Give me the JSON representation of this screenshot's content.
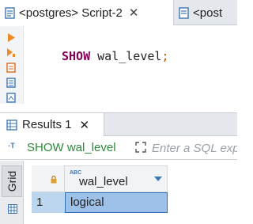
{
  "editor": {
    "tabs": [
      {
        "label": "<postgres> Script-2",
        "close": "✕"
      },
      {
        "label": "<post"
      }
    ],
    "code": {
      "keyword": "SHOW",
      "identifier": "wal_level",
      "terminator": ";"
    },
    "scroll_arrow": "◀"
  },
  "results": {
    "tab_label": "Results 1",
    "tab_close": "✕",
    "query_text": "SHOW wal_level",
    "filter_placeholder": "Enter a SQL expression to filter results",
    "side_tab": "Grid",
    "columns": [
      {
        "type_badge": "ABC",
        "name": "wal_level"
      }
    ],
    "rows": [
      {
        "num": "1",
        "values": [
          "logical"
        ]
      }
    ]
  },
  "colors": {
    "keyword": "#7f0055",
    "selection": "#9dc1e8",
    "query_text": "#2d8a3a"
  },
  "icons": [
    "sql-file-icon",
    "run-arrow-icon",
    "execute-script-icon",
    "explain-icon",
    "text-icon",
    "lock-icon",
    "expand-icon",
    "grid-icon"
  ]
}
